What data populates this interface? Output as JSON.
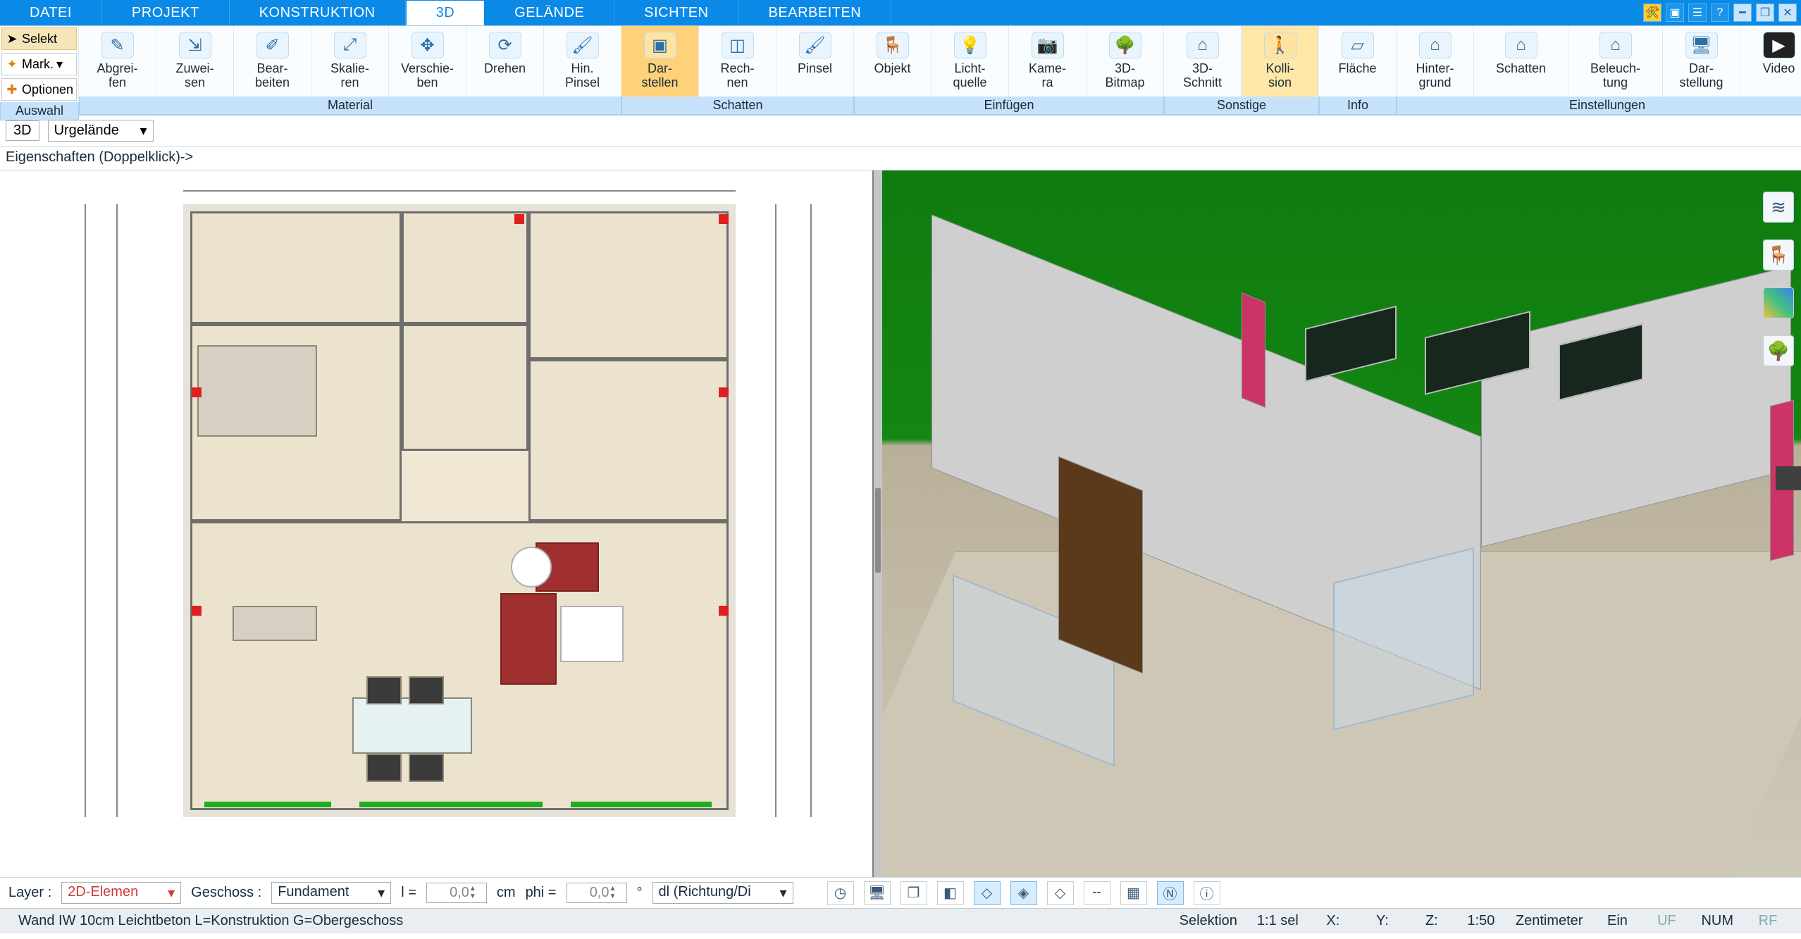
{
  "tabs": {
    "datei": "DATEI",
    "projekt": "PROJEKT",
    "konstruktion": "KONSTRUKTION",
    "d3": "3D",
    "gelaende": "GELÄNDE",
    "sichten": "SICHTEN",
    "bearbeiten": "BEARBEITEN"
  },
  "sel": {
    "selekt": "Selekt",
    "mark": "Mark.",
    "optionen": "Optionen",
    "label": "Auswahl"
  },
  "grp": {
    "material": "Material",
    "schatten": "Schatten",
    "einfuegen": "Einfügen",
    "sonstige": "Sonstige",
    "info": "Info",
    "einstellungen": "Einstellungen"
  },
  "btn": {
    "abgreifen": "Abgrei-\nfen",
    "zuweisen": "Zuwei-\nsen",
    "bearbeiten": "Bear-\nbeiten",
    "skalieren": "Skalie-\nren",
    "verschieben": "Verschie-\nben",
    "drehen": "Drehen",
    "hinpinsel": "Hin.\nPinsel",
    "darstellen": "Dar-\nstellen",
    "rechnen": "Rech-\nnen",
    "pinsel": "Pinsel",
    "objekt": "Objekt",
    "lichtquelle": "Licht-\nquelle",
    "kamera": "Kame-\nra",
    "bitmap3d": "3D-\nBitmap",
    "schnitt3d": "3D-\nSchnitt",
    "kollision": "Kolli-\nsion",
    "flaeche": "Fläche",
    "hintergrund": "Hinter-\ngrund",
    "schatten": "Schatten",
    "beleuchtung": "Beleuch-\ntung",
    "darstellung": "Dar-\nstellung",
    "video": "Video"
  },
  "subbar": {
    "tag3d": "3D",
    "layer_drop": "Urgelände"
  },
  "props": {
    "hint": "Eigenschaften (Doppelklick)->"
  },
  "param": {
    "layer_lbl": "Layer :",
    "layer_val": "2D-Elemen",
    "geschoss_lbl": "Geschoss :",
    "geschoss_val": "Fundament",
    "l_lbl": "l =",
    "l_val": "0,0",
    "l_unit": "cm",
    "phi_lbl": "phi =",
    "phi_val": "0,0",
    "phi_unit": "°",
    "dl_val": "dl (Richtung/Di"
  },
  "status": {
    "left": "Wand IW 10cm Leichtbeton L=Konstruktion G=Obergeschoss",
    "sel": "Selektion",
    "ratio": "1:1 sel",
    "x": "X:",
    "y": "Y:",
    "z": "Z:",
    "scale": "1:50",
    "unit": "Zentimeter",
    "ein": "Ein",
    "uf": "UF",
    "num": "NUM",
    "rf": "RF"
  }
}
